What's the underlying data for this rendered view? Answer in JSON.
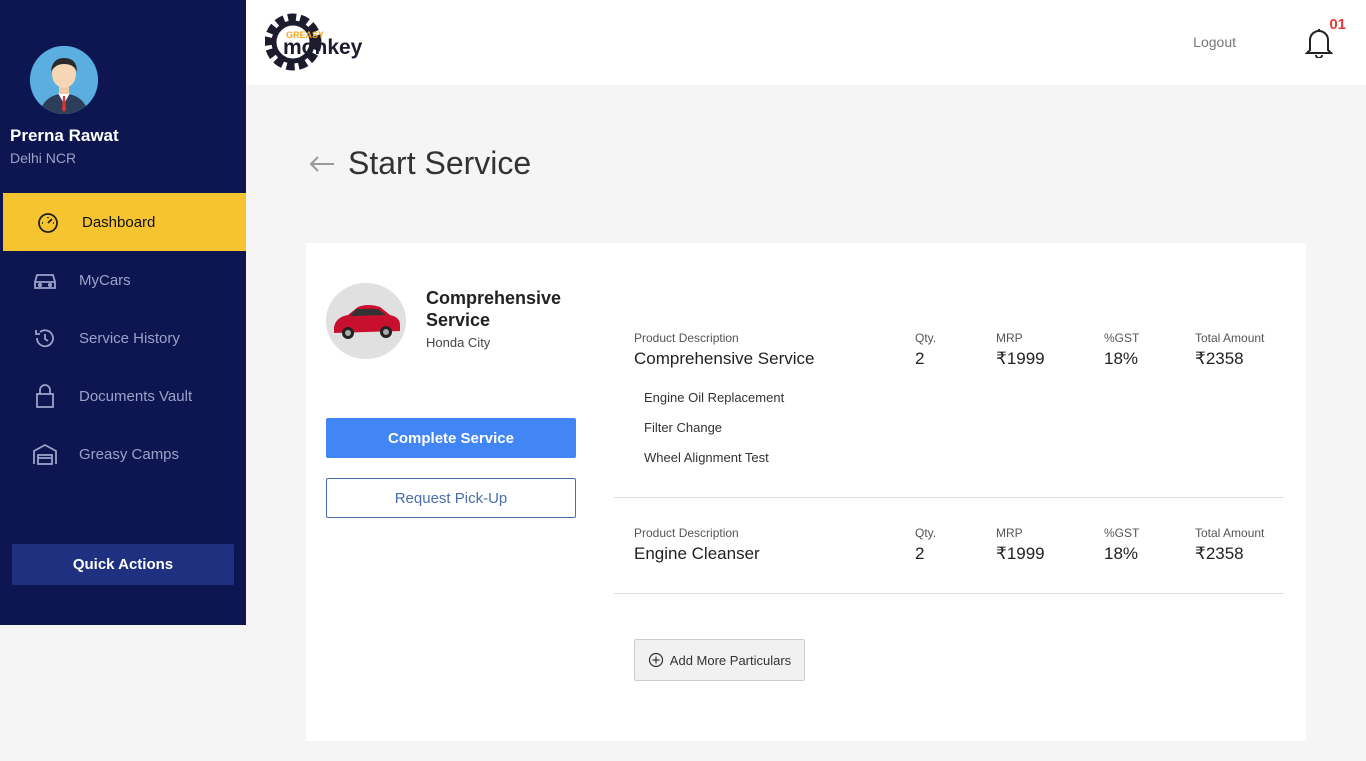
{
  "user": {
    "name": "Prerna Rawat",
    "location": "Delhi NCR"
  },
  "nav": [
    {
      "label": "Dashboard",
      "icon": "speedometer-icon",
      "active": true
    },
    {
      "label": "MyCars",
      "icon": "car-icon",
      "active": false
    },
    {
      "label": "Service History",
      "icon": "history-icon",
      "active": false
    },
    {
      "label": "Documents Vault",
      "icon": "lock-icon",
      "active": false
    },
    {
      "label": "Greasy Camps",
      "icon": "garage-icon",
      "active": false
    }
  ],
  "quick_actions_label": "Quick Actions",
  "header": {
    "logo_top": "GREASY",
    "logo_text": "monkey",
    "logout_label": "Logout",
    "notification_count": "01"
  },
  "page_title": "Start Service",
  "service": {
    "name": "Comprehensive Service",
    "car_model": "Honda City",
    "complete_label": "Complete Service",
    "pickup_label": "Request Pick-Up"
  },
  "columns": {
    "desc": "Product Description",
    "qty": "Qty.",
    "mrp": "MRP",
    "gst": "%GST",
    "total": "Total Amount"
  },
  "line_items": [
    {
      "description": "Comprehensive Service",
      "qty": "2",
      "mrp": "₹1999",
      "gst": "18%",
      "total": "₹2358",
      "sub_items": [
        "Engine Oil Replacement",
        "Filter Change",
        "Wheel Alignment Test"
      ]
    },
    {
      "description": "Engine Cleanser",
      "qty": "2",
      "mrp": "₹1999",
      "gst": "18%",
      "total": "₹2358",
      "sub_items": []
    }
  ],
  "add_more_label": "Add More Particulars",
  "colors": {
    "sidebar": "#0d1650",
    "active": "#f5c42f",
    "primary": "#4285f4",
    "badge": "#e53935"
  }
}
